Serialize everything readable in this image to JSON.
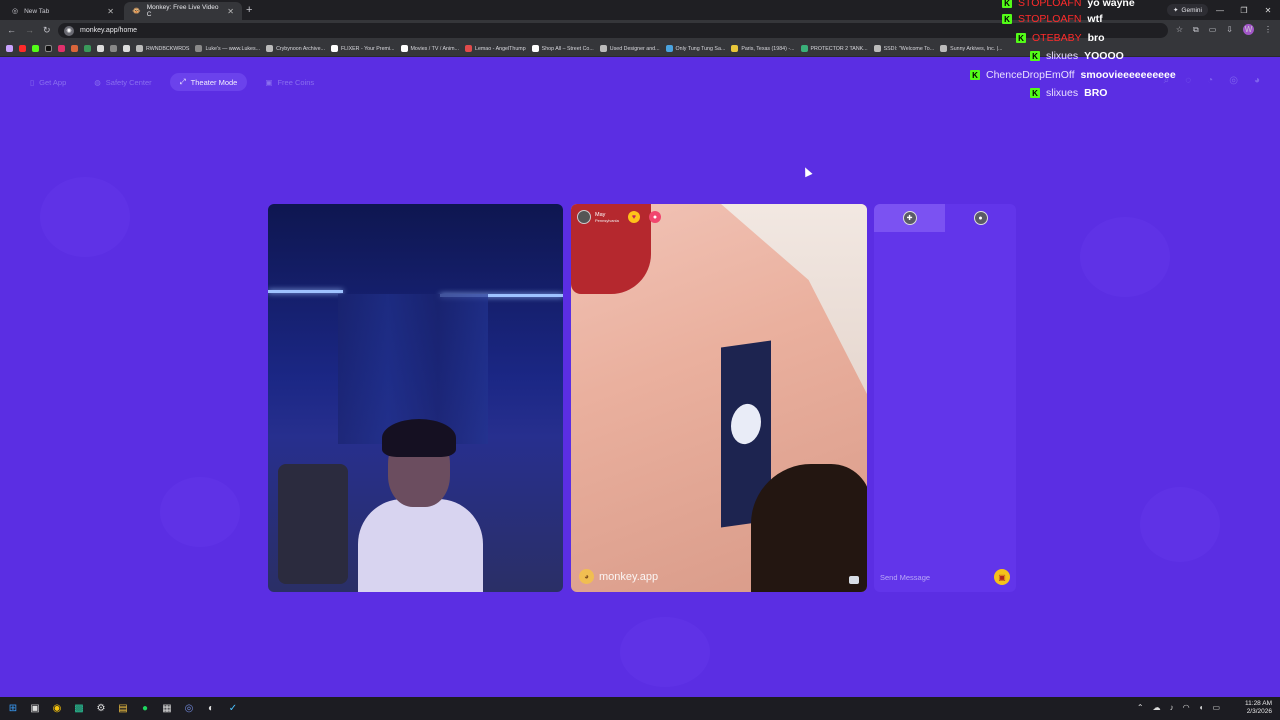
{
  "browser": {
    "tabs": [
      {
        "title": "New Tab",
        "active": false
      },
      {
        "title": "Monkey: Free Live Video C",
        "active": true
      }
    ],
    "new_tab_symbol": "+",
    "url": "monkey.app/home",
    "gemini_label": "Gemini",
    "bookmarks": [
      {
        "label": "RWNDBCKWRDS",
        "color": "#bbbbbb"
      },
      {
        "label": "Luke's — www.Lukes...",
        "color": "#8a8a8a"
      },
      {
        "label": "Crybynoon Archive...",
        "color": "#bbbbbb"
      },
      {
        "label": "FLIXER - Your Premi...",
        "color": "#ffffff"
      },
      {
        "label": "Movies / TV / Anim...",
        "color": "#ffffff"
      },
      {
        "label": "Lemao - AngelThump",
        "color": "#e14b4b"
      },
      {
        "label": "Shop All – Street Co...",
        "color": "#ffffff"
      },
      {
        "label": "Used Designer and...",
        "color": "#bbbbbb"
      },
      {
        "label": "Only Tung Tung Sa...",
        "color": "#4aa3df"
      },
      {
        "label": "Paris, Texas (1984) -...",
        "color": "#e8c63a"
      },
      {
        "label": "PROTECTOR 2 TANK...",
        "color": "#3ab07a"
      },
      {
        "label": "SSDI: \"Welcome To...",
        "color": "#bbbbbb"
      },
      {
        "label": "Sunny Arkives, Inc. |...",
        "color": "#bbbbbb"
      }
    ]
  },
  "site": {
    "nav": [
      {
        "label": "Get App",
        "icon": "phone-icon",
        "active": false
      },
      {
        "label": "Safety Center",
        "icon": "shield-icon",
        "active": false
      },
      {
        "label": "Theater Mode",
        "icon": "expand-icon",
        "active": true
      },
      {
        "label": "Free Coins",
        "icon": "coin-icon",
        "active": false
      }
    ],
    "remote_user": {
      "name": "May",
      "location": "Pennsylvania"
    },
    "watermark": "monkey.app",
    "chat": {
      "placeholder": "Send Message"
    }
  },
  "stream_chat": [
    {
      "user": "STOPLOAFN",
      "text": "yo wayne",
      "user_color": "#ff2b2b"
    },
    {
      "user": "STOPLOAFN",
      "text": "wtf",
      "user_color": "#ff2b2b"
    },
    {
      "user": "OTEBABY",
      "text": "bro",
      "user_color": "#ff2b2b"
    },
    {
      "user": "slixues",
      "text": "YOOOO",
      "user_color": "#e9e0ff"
    },
    {
      "user": "ChenceDropEmOff",
      "text": "smoovieeeeeeeeee",
      "user_color": "#e9e0ff"
    },
    {
      "user": "slixues",
      "text": "BRO",
      "user_color": "#e9e0ff"
    }
  ],
  "taskbar": {
    "time": "11:28 AM",
    "date": "2/3/2026"
  },
  "colors": {
    "page_bg": "#5b2ee3",
    "accent": "#6b42ec",
    "kick_green": "#53fc18"
  }
}
